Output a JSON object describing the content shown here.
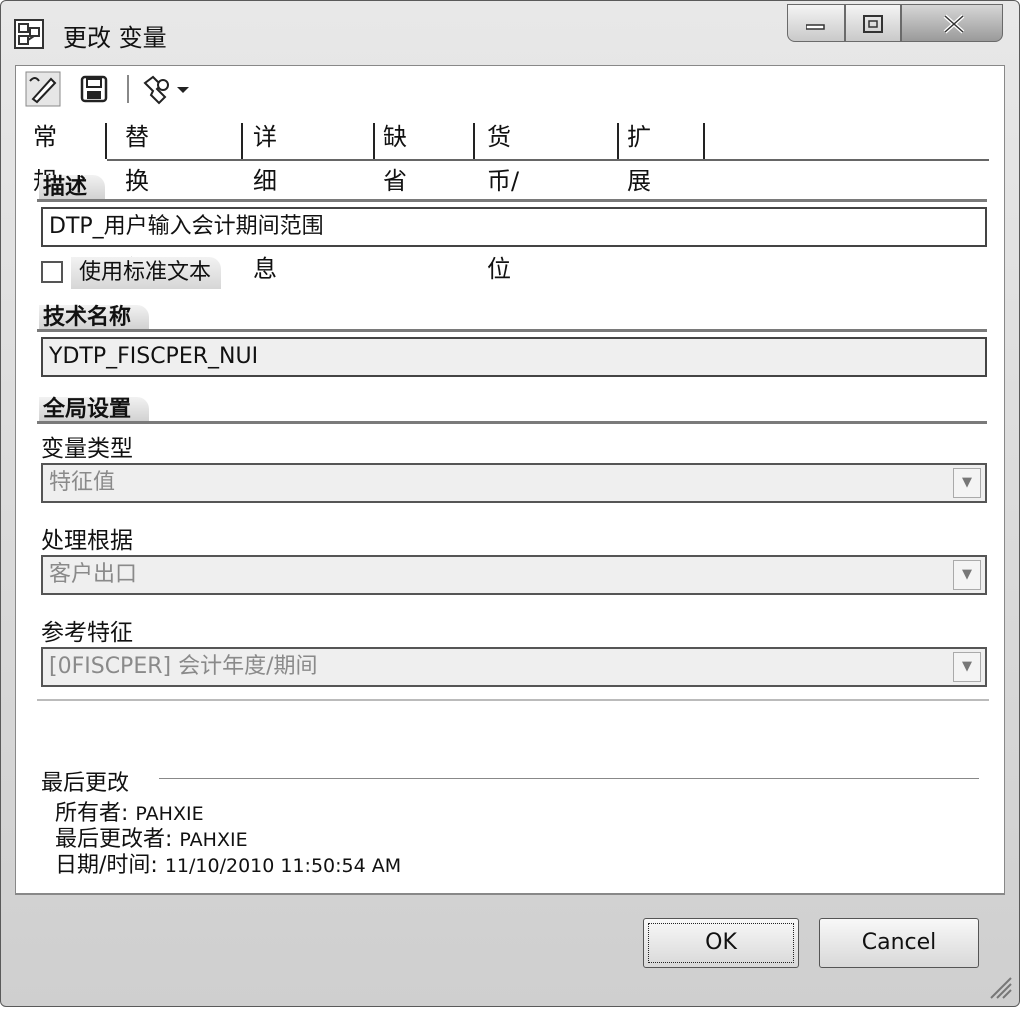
{
  "window": {
    "title": "更改 变量",
    "app_icon": "variable-dialog-icon",
    "controls": {
      "minimize": "minimize-icon",
      "maximize": "maximize-icon",
      "close": "close-icon"
    }
  },
  "toolbar": {
    "icons": [
      "edit-pencil-icon",
      "save-disk-icon",
      "tools-wrench-icon",
      "dropdown-arrow-icon"
    ]
  },
  "tabs": [
    {
      "label": "常规",
      "active": true
    },
    {
      "label": "替换路径",
      "active": false
    },
    {
      "label": "详细信息",
      "active": false
    },
    {
      "label": "缺省值",
      "active": false
    },
    {
      "label": "货币/单位",
      "active": false
    },
    {
      "label": "扩展",
      "active": false
    }
  ],
  "description": {
    "header": "描述",
    "value": "DTP_用户输入会计期间范围",
    "use_standard_text": {
      "label": "使用标准文本",
      "checked": false
    }
  },
  "technical_name": {
    "header": "技术名称",
    "value": "YDTP_FISCPER_NUI"
  },
  "global_settings": {
    "header": "全局设置",
    "variable_type": {
      "label": "变量类型",
      "value": "特征值"
    },
    "processing_by": {
      "label": "处理根据",
      "value": "客户出口"
    },
    "reference_characteristic": {
      "label": "参考特征",
      "value": "[0FISCPER] 会计年度/期间"
    }
  },
  "last_changed": {
    "header": "最后更改",
    "owner_label": "所有者:",
    "owner_value": "PAHXIE",
    "changed_by_label": "最后更改者:",
    "changed_by_value": "PAHXIE",
    "datetime_label": "日期/时间:",
    "datetime_value": "11/10/2010  11:50:54 AM"
  },
  "buttons": {
    "ok": "OK",
    "cancel": "Cancel"
  }
}
